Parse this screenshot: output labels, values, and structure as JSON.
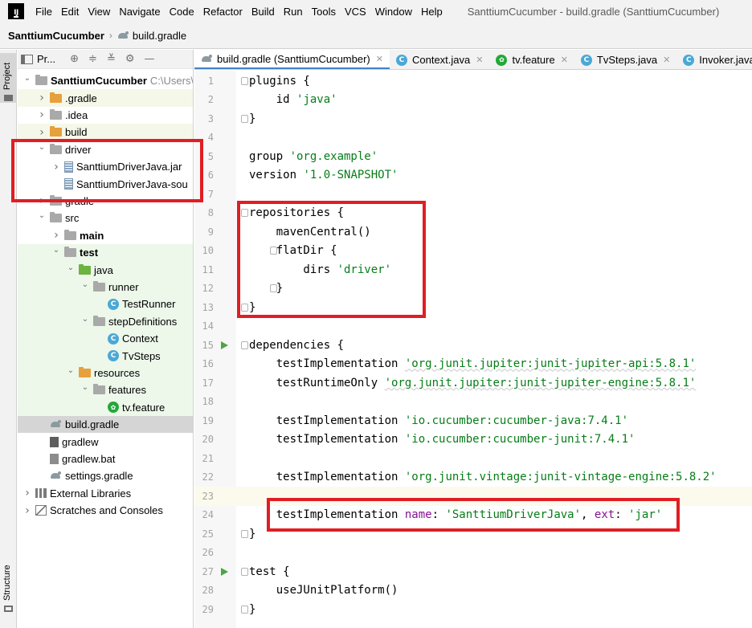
{
  "menu": [
    "File",
    "Edit",
    "View",
    "Navigate",
    "Code",
    "Refactor",
    "Build",
    "Run",
    "Tools",
    "VCS",
    "Window",
    "Help"
  ],
  "window_title": "SanttiumCucumber - build.gradle (SanttiumCucumber)",
  "logo_text": "IJ",
  "breadcrumb": {
    "project": "SanttiumCucumber",
    "file": "build.gradle"
  },
  "left_strip": {
    "project_label": "Project",
    "structure_label": "Structure"
  },
  "project_panel": {
    "title": "Pr...",
    "tools": [
      "⊕",
      "≑",
      "≚",
      "⚙",
      "—"
    ],
    "tree": [
      {
        "label": "SanttiumCucumber",
        "extra": "C:\\Users\\",
        "indent": 0,
        "arrow": "open",
        "icon": "folder",
        "bold": true,
        "style": ""
      },
      {
        "label": ".gradle",
        "indent": 1,
        "arrow": "closed",
        "icon": "folder-orange",
        "style": "hl"
      },
      {
        "label": ".idea",
        "indent": 1,
        "arrow": "closed",
        "icon": "folder",
        "style": ""
      },
      {
        "label": "build",
        "indent": 1,
        "arrow": "closed",
        "icon": "folder-orange",
        "style": "hl"
      },
      {
        "label": "driver",
        "indent": 1,
        "arrow": "open",
        "icon": "folder",
        "style": ""
      },
      {
        "label": "SanttiumDriverJava.jar",
        "indent": 2,
        "arrow": "closed",
        "icon": "jar",
        "style": ""
      },
      {
        "label": "SanttiumDriverJava-sou",
        "indent": 2,
        "arrow": "none",
        "icon": "jar",
        "style": ""
      },
      {
        "label": "gradle",
        "indent": 1,
        "arrow": "closed",
        "icon": "folder",
        "style": ""
      },
      {
        "label": "src",
        "indent": 1,
        "arrow": "open",
        "icon": "folder",
        "style": ""
      },
      {
        "label": "main",
        "indent": 2,
        "arrow": "closed",
        "icon": "folder",
        "bold": true,
        "style": ""
      },
      {
        "label": "test",
        "indent": 2,
        "arrow": "open",
        "icon": "folder",
        "bold": true,
        "style": "green"
      },
      {
        "label": "java",
        "indent": 3,
        "arrow": "open",
        "icon": "folder-green",
        "style": "green"
      },
      {
        "label": "runner",
        "indent": 4,
        "arrow": "open",
        "icon": "folder",
        "style": "green"
      },
      {
        "label": "TestRunner",
        "indent": 5,
        "arrow": "none",
        "icon": "class",
        "style": "green"
      },
      {
        "label": "stepDefinitions",
        "indent": 4,
        "arrow": "open",
        "icon": "folder",
        "style": "green"
      },
      {
        "label": "Context",
        "indent": 5,
        "arrow": "none",
        "icon": "class",
        "style": "green"
      },
      {
        "label": "TvSteps",
        "indent": 5,
        "arrow": "none",
        "icon": "class",
        "style": "green"
      },
      {
        "label": "resources",
        "indent": 3,
        "arrow": "open",
        "icon": "folder-orange",
        "style": "green"
      },
      {
        "label": "features",
        "indent": 4,
        "arrow": "open",
        "icon": "folder",
        "style": "green"
      },
      {
        "label": "tv.feature",
        "indent": 5,
        "arrow": "none",
        "icon": "cucumber",
        "style": "green"
      },
      {
        "label": "build.gradle",
        "indent": 1,
        "arrow": "none",
        "icon": "gradle",
        "style": "selected"
      },
      {
        "label": "gradlew",
        "indent": 1,
        "arrow": "none",
        "icon": "file-term",
        "style": ""
      },
      {
        "label": "gradlew.bat",
        "indent": 1,
        "arrow": "none",
        "icon": "file",
        "style": ""
      },
      {
        "label": "settings.gradle",
        "indent": 1,
        "arrow": "none",
        "icon": "gradle",
        "style": ""
      },
      {
        "label": "External Libraries",
        "indent": 0,
        "arrow": "closed",
        "icon": "lib",
        "style": ""
      },
      {
        "label": "Scratches and Consoles",
        "indent": 0,
        "arrow": "closed",
        "icon": "scratch",
        "style": ""
      }
    ]
  },
  "tabs": [
    {
      "label": "build.gradle (SanttiumCucumber)",
      "icon": "gradle",
      "active": true
    },
    {
      "label": "Context.java",
      "icon": "class",
      "active": false
    },
    {
      "label": "tv.feature",
      "icon": "cucumber",
      "active": false
    },
    {
      "label": "TvSteps.java",
      "icon": "class",
      "active": false
    },
    {
      "label": "Invoker.java",
      "icon": "class",
      "active": false
    }
  ],
  "editor": {
    "lines": [
      {
        "n": "1",
        "fold": true,
        "segments": [
          [
            "t",
            "plugins {"
          ]
        ]
      },
      {
        "n": "2",
        "segments": [
          [
            "t",
            "    id "
          ],
          [
            "s",
            "'java'"
          ]
        ]
      },
      {
        "n": "3",
        "fold": true,
        "segments": [
          [
            "t",
            "}"
          ]
        ]
      },
      {
        "n": "4",
        "segments": []
      },
      {
        "n": "5",
        "segments": [
          [
            "t",
            "group "
          ],
          [
            "s",
            "'org.example'"
          ]
        ]
      },
      {
        "n": "6",
        "segments": [
          [
            "t",
            "version "
          ],
          [
            "s",
            "'1.0-SNAPSHOT'"
          ]
        ]
      },
      {
        "n": "7",
        "segments": []
      },
      {
        "n": "8",
        "fold": true,
        "segments": [
          [
            "t",
            "repositories {"
          ]
        ]
      },
      {
        "n": "9",
        "segments": [
          [
            "t",
            "    mavenCentral()"
          ]
        ]
      },
      {
        "n": "10",
        "fold2": true,
        "segments": [
          [
            "t",
            "    flatDir {"
          ]
        ]
      },
      {
        "n": "11",
        "segments": [
          [
            "t",
            "        dirs "
          ],
          [
            "s",
            "'driver'"
          ]
        ]
      },
      {
        "n": "12",
        "fold2": true,
        "segments": [
          [
            "t",
            "    }"
          ]
        ]
      },
      {
        "n": "13",
        "fold": true,
        "segments": [
          [
            "t",
            "}"
          ]
        ]
      },
      {
        "n": "14",
        "segments": []
      },
      {
        "n": "15",
        "run": true,
        "fold": true,
        "segments": [
          [
            "t",
            "dependencies {"
          ]
        ]
      },
      {
        "n": "16",
        "segments": [
          [
            "t",
            "    testImplementation "
          ],
          [
            "q",
            "'org.junit.jupiter:junit-jupiter-api:5.8.1'"
          ]
        ]
      },
      {
        "n": "17",
        "segments": [
          [
            "t",
            "    testRuntimeOnly "
          ],
          [
            "q",
            "'org.junit.jupiter:junit-jupiter-engine:5.8.1'"
          ]
        ]
      },
      {
        "n": "18",
        "segments": []
      },
      {
        "n": "19",
        "segments": [
          [
            "t",
            "    testImplementation "
          ],
          [
            "s",
            "'io.cucumber:cucumber-java:7.4.1'"
          ]
        ]
      },
      {
        "n": "20",
        "segments": [
          [
            "t",
            "    testImplementation "
          ],
          [
            "s",
            "'io.cucumber:cucumber-junit:7.4.1'"
          ]
        ]
      },
      {
        "n": "21",
        "segments": []
      },
      {
        "n": "22",
        "segments": [
          [
            "t",
            "    testImplementation "
          ],
          [
            "s",
            "'org.junit.vintage:junit-vintage-engine:5.8.2'"
          ]
        ]
      },
      {
        "n": "23",
        "current": true,
        "segments": []
      },
      {
        "n": "24",
        "segments": [
          [
            "t",
            "    testImplementation "
          ],
          [
            "p",
            "name"
          ],
          [
            "t",
            ": "
          ],
          [
            "s",
            "'SanttiumDriverJava'"
          ],
          [
            "t",
            ", "
          ],
          [
            "p",
            "ext"
          ],
          [
            "t",
            ": "
          ],
          [
            "s",
            "'jar'"
          ]
        ]
      },
      {
        "n": "25",
        "fold": true,
        "segments": [
          [
            "t",
            "}"
          ]
        ]
      },
      {
        "n": "26",
        "segments": []
      },
      {
        "n": "27",
        "run": true,
        "fold": true,
        "segments": [
          [
            "t",
            "test {"
          ]
        ]
      },
      {
        "n": "28",
        "segments": [
          [
            "t",
            "    useJUnitPlatform()"
          ]
        ]
      },
      {
        "n": "29",
        "fold": true,
        "segments": [
          [
            "t",
            "}"
          ]
        ]
      }
    ]
  },
  "colors": {
    "annotation": "#e01e24",
    "string": "#067d17",
    "named_arg": "#871094",
    "run_marker": "#4ca547"
  }
}
